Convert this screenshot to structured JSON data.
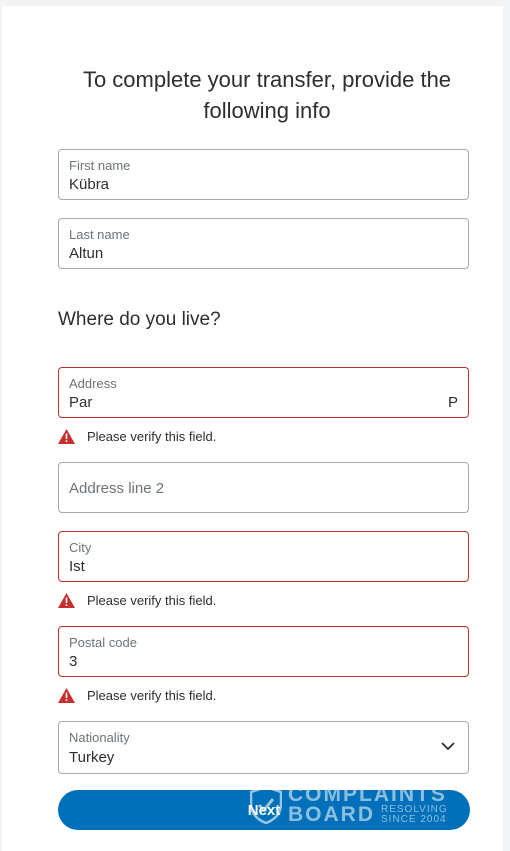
{
  "form": {
    "title_line1": "To complete your transfer, provide the",
    "title_line2": "following info",
    "first_name": {
      "label": "First name",
      "value": "Kübra"
    },
    "last_name": {
      "label": "Last name",
      "value": "Altun"
    },
    "section_title": "Where do you live?",
    "address": {
      "label": "Address",
      "value": "Par",
      "tail": "P"
    },
    "address_error": "Please verify this field.",
    "address2": {
      "placeholder": "Address line 2"
    },
    "city": {
      "label": "City",
      "value": "Ist"
    },
    "city_error": "Please verify this field.",
    "postal": {
      "label": "Postal code",
      "value": "3"
    },
    "postal_error": "Please verify this field.",
    "nationality": {
      "label": "Nationality",
      "value": "Turkey"
    },
    "next_label": "Next"
  },
  "watermark": {
    "line1": "COMPLAINTS",
    "line2": "BOARD",
    "line3a": "RESOLVING",
    "line3b": "SINCE 2004"
  },
  "colors": {
    "accent": "#0070ba",
    "error": "#c72e2e"
  },
  "icons": {
    "error": "warning-triangle-icon",
    "dropdown": "chevron-down-icon"
  }
}
